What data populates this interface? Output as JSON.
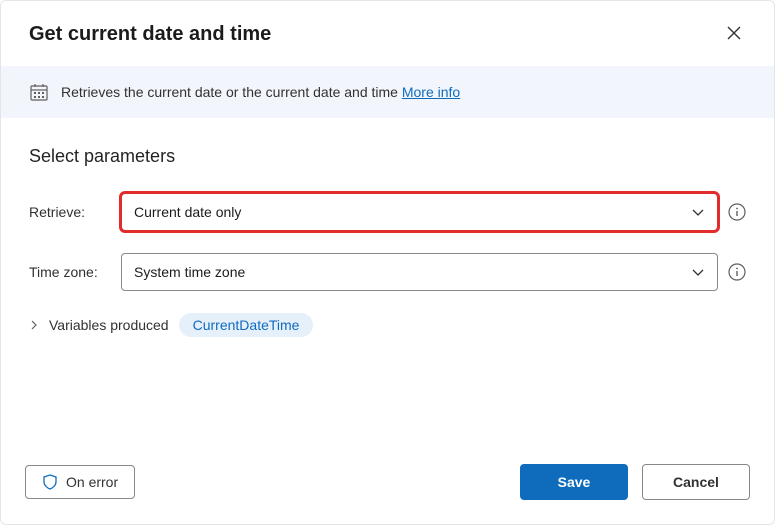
{
  "header": {
    "title": "Get current date and time"
  },
  "banner": {
    "text": "Retrieves the current date or the current date and time ",
    "link": "More info"
  },
  "section": {
    "title": "Select parameters"
  },
  "fields": {
    "retrieve": {
      "label": "Retrieve:",
      "value": "Current date only"
    },
    "timezone": {
      "label": "Time zone:",
      "value": "System time zone"
    }
  },
  "variables": {
    "label": "Variables produced",
    "chip": "CurrentDateTime"
  },
  "footer": {
    "on_error": "On error",
    "save": "Save",
    "cancel": "Cancel"
  }
}
